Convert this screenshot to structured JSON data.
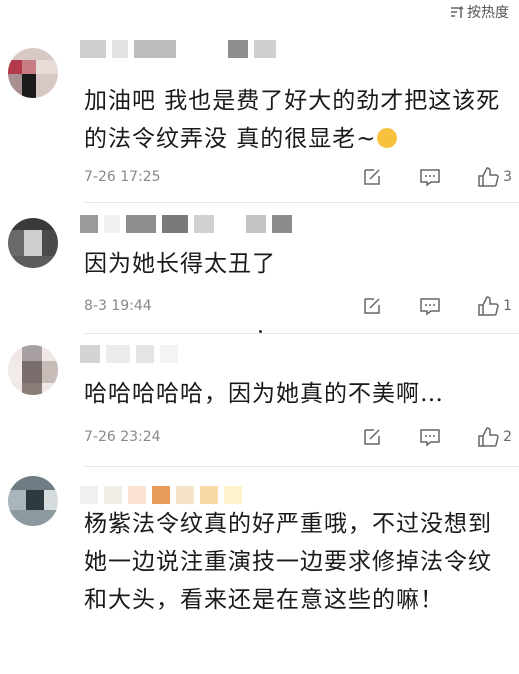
{
  "sort": {
    "label": "按热度"
  },
  "comments": [
    {
      "text": "加油吧 我也是费了好大的劲才把这该死的法令纹弄没 真的很显老~",
      "time": "7-26 17:25",
      "likes": "3"
    },
    {
      "text": "因为她长得太丑了",
      "time": "8-3 19:44",
      "likes": "1"
    },
    {
      "text": "哈哈哈哈哈，因为她真的不美啊…",
      "time": "7-26 23:24",
      "likes": "2"
    },
    {
      "text": "杨紫法令纹真的好严重哦，不过没想到她一边说注重演技一边要求修掉法令纹和大头，看来还是在意这些的嘛！",
      "time": "",
      "likes": ""
    }
  ]
}
